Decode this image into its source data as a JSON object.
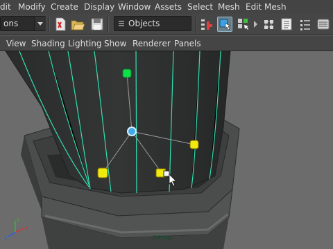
{
  "menubar": {
    "items": [
      "dit",
      "Modify",
      "Create",
      "Display",
      "Window",
      "Assets",
      "Select",
      "Mesh",
      "Edit Mesh"
    ]
  },
  "shelf": {
    "menuset_value": "ons",
    "selection_mode_value": "Objects",
    "icons": [
      "new-scene-icon",
      "open-scene-icon",
      "save-scene-icon",
      "selection-mask-icon",
      "select-by-hierarchy-icon",
      "select-by-object-icon",
      "select-by-component-icon",
      "snap-to-grid-icon",
      "history-icon",
      "render-frame-icon",
      "render-settings-icon",
      "hypershade-icon"
    ]
  },
  "panel_menu": {
    "items": [
      "View",
      "Shading",
      "Lighting",
      "Show",
      "Renderer",
      "Panels"
    ]
  },
  "viewport": {
    "camera_label": "persp",
    "axis": {
      "x": "x",
      "y": "y",
      "z": "z"
    },
    "colors": {
      "background": "#6c6c6c",
      "mesh": "#2f3131",
      "wireframe": "#34e0b2",
      "handle_green": "#0ee04a",
      "handle_blue": "#43a9e6",
      "handle_yellow": "#f0ea10"
    }
  }
}
